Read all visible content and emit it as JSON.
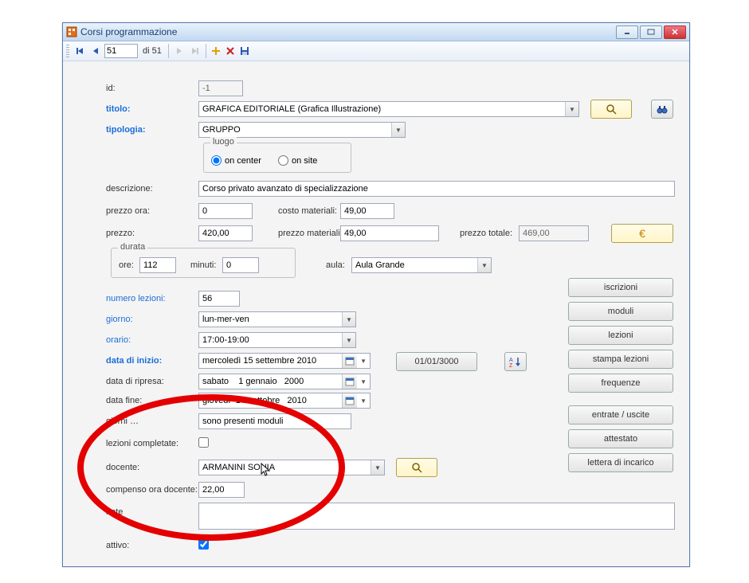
{
  "window": {
    "title": "Corsi programmazione"
  },
  "nav": {
    "pos": "51",
    "total_label": "di 51"
  },
  "labels": {
    "id": "id:",
    "titolo": "titolo:",
    "tipologia": "tipologia:",
    "luogo": "luogo",
    "on_center": "on center",
    "on_site": "on site",
    "descrizione": "descrizione:",
    "prezzo_ora": "prezzo ora:",
    "costo_materiali": "costo materiali:",
    "prezzo": "prezzo:",
    "prezzo_materiali": "prezzo materiali:",
    "prezzo_totale": "prezzo totale:",
    "durata": "durata",
    "ore": "ore:",
    "minuti": "minuti:",
    "aula": "aula:",
    "numero_lezioni": "numero lezioni:",
    "giorno": "giorno:",
    "orario": "orario:",
    "data_inizio": "data di inizio:",
    "data_ripresa": "data di ripresa:",
    "data_fine": "data fine:",
    "giorni_moduli": "giorni …",
    "lezioni_completate": "lezioni completate:",
    "docente": "docente:",
    "compenso": "compenso ora docente:",
    "note": "note",
    "attivo": "attivo:"
  },
  "values": {
    "id": "-1",
    "titolo": "GRAFICA EDITORIALE (Grafica Illustrazione)",
    "tipologia": "GRUPPO",
    "luogo_selected": "on_center",
    "descrizione": "Corso privato avanzato di specializzazione",
    "prezzo_ora": "0",
    "costo_materiali": "49,00",
    "prezzo": "420,00",
    "prezzo_materiali": "49,00",
    "prezzo_totale": "469,00",
    "ore": "112",
    "minuti": "0",
    "aula": "Aula Grande",
    "numero_lezioni": "56",
    "giorno": "lun-mer-ven",
    "orario": "17:00-19:00",
    "data_inizio": "mercoledì 15 settembre 2010",
    "data_ripresa": "sabato    1 gennaio   2000",
    "data_fine": "giovedì  14   ottobre   2010",
    "giorni_moduli": "sono presenti moduli",
    "lezioni_completate": false,
    "docente": "ARMANINI SONIA",
    "compenso": "22,00",
    "note": "",
    "attivo": true,
    "data_extra": "01/01/3000"
  },
  "side_buttons": {
    "iscrizioni": "iscrizioni",
    "moduli": "moduli",
    "lezioni": "lezioni",
    "stampa_lezioni": "stampa lezioni",
    "frequenze": "frequenze",
    "entrate_uscite": "entrate / uscite",
    "attestato": "attestato",
    "lettera_incarico": "lettera di incarico"
  },
  "icons": {
    "euro": "€"
  }
}
